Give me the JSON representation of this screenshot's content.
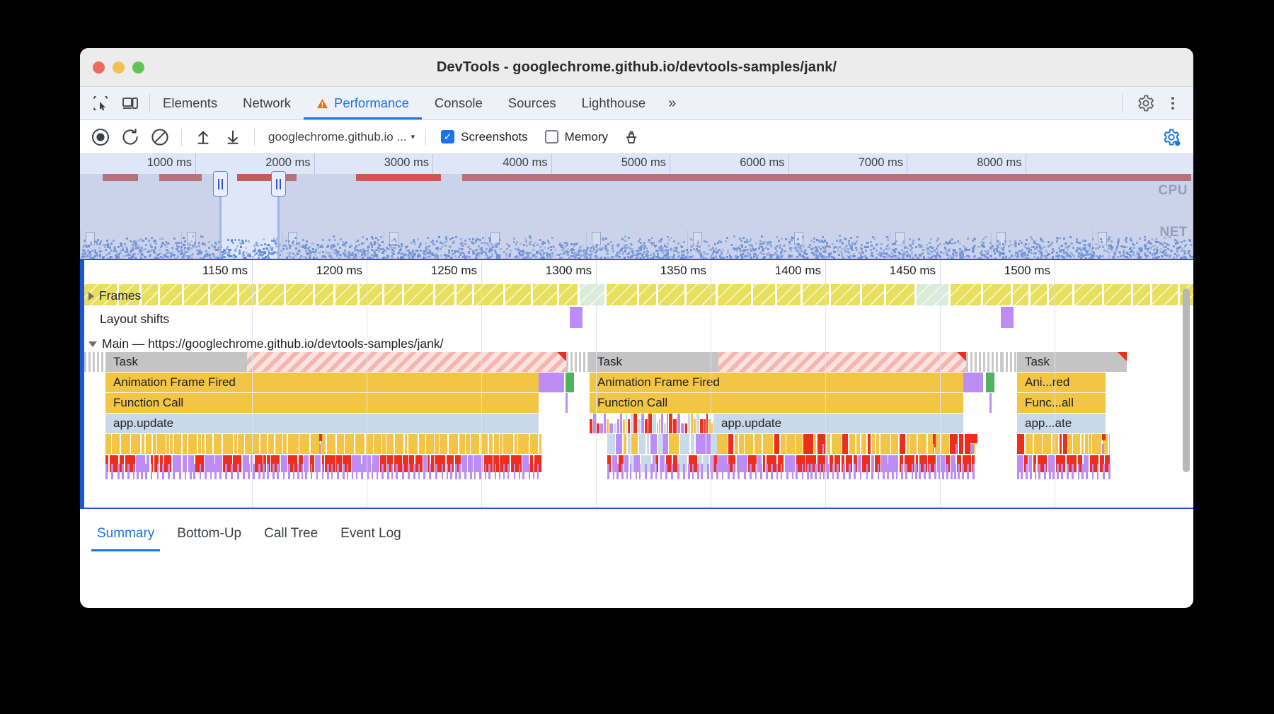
{
  "window": {
    "title": "DevTools - googlechrome.github.io/devtools-samples/jank/",
    "traffic": {
      "close": "close-button",
      "minimize": "minimize-button",
      "zoom": "zoom-button"
    }
  },
  "tabstrip": {
    "inspect_icon": "inspect-element-icon",
    "device_icon": "device-toolbar-icon",
    "tabs": [
      {
        "label": "Elements",
        "active": false,
        "warn": false
      },
      {
        "label": "Network",
        "active": false,
        "warn": false
      },
      {
        "label": "Performance",
        "active": true,
        "warn": true
      },
      {
        "label": "Console",
        "active": false,
        "warn": false
      },
      {
        "label": "Sources",
        "active": false,
        "warn": false
      },
      {
        "label": "Lighthouse",
        "active": false,
        "warn": false
      }
    ],
    "more_tabs": "»",
    "settings_icon": "gear-icon",
    "menu_icon": "kebab-menu-icon"
  },
  "toolbar": {
    "record_icon": "record-icon",
    "reload_icon": "reload-and-record-icon",
    "clear_icon": "clear-recording-icon",
    "upload_icon": "load-profile-icon",
    "download_icon": "save-profile-icon",
    "target_value": "googlechrome.github.io ...",
    "target_caret": "▾",
    "screenshots_label": "Screenshots",
    "screenshots_checked": true,
    "memory_label": "Memory",
    "memory_checked": false,
    "gc_icon": "collect-garbage-icon",
    "capture_settings_icon": "capture-settings-gear-icon",
    "accent": "#1a73e8"
  },
  "overview": {
    "ruler_ticks": [
      "1000 ms",
      "2000 ms",
      "3000 ms",
      "4000 ms",
      "5000 ms",
      "6000 ms",
      "7000 ms",
      "8000 ms"
    ],
    "cpu_label": "CPU",
    "net_label": "NET",
    "selection": {
      "start_pct": 12.6,
      "end_pct": 17.8
    }
  },
  "flame": {
    "ruler_ticks": [
      "1150 ms",
      "1200 ms",
      "1250 ms",
      "1300 ms",
      "1350 ms",
      "1400 ms",
      "1450 ms",
      "1500 ms"
    ],
    "frames_label": "Frames",
    "frames_expand": "expand-frames-triangle",
    "layout_shifts_label": "Layout shifts",
    "main_label": "Main — https://googlechrome.github.io/devtools-samples/jank/",
    "main_collapse": "collapse-main-triangle",
    "tracks": [
      {
        "name": "task-1",
        "label": "Task"
      },
      {
        "name": "task-2",
        "label": "Task"
      },
      {
        "name": "task-3",
        "label": "Task"
      },
      {
        "name": "anim-1",
        "label": "Animation Frame Fired"
      },
      {
        "name": "anim-2",
        "label": "Animation Frame Fired"
      },
      {
        "name": "anim-3",
        "label": "Ani...red"
      },
      {
        "name": "fn-1",
        "label": "Function Call"
      },
      {
        "name": "fn-2",
        "label": "Function Call"
      },
      {
        "name": "fn-3",
        "label": "Func...all"
      },
      {
        "name": "upd-1",
        "label": "app.update"
      },
      {
        "name": "upd-2",
        "label": "app.update"
      },
      {
        "name": "upd-3",
        "label": "app...ate"
      }
    ],
    "colors": {
      "frame": "#e8df5c",
      "frame_partial": "#d8ecd8",
      "layout_shift": "#bd8df5",
      "task": "#c4c4c4",
      "long_task_hatch": "#f3b6b0",
      "scripting": "#f2c545",
      "update": "#c8d9ea",
      "rendering": "#bd8df5",
      "painting": "#4eb25e",
      "warning": "#ee2d1b"
    }
  },
  "bottom_tabs": [
    {
      "label": "Summary",
      "active": true
    },
    {
      "label": "Bottom-Up",
      "active": false
    },
    {
      "label": "Call Tree",
      "active": false
    },
    {
      "label": "Event Log",
      "active": false
    }
  ]
}
